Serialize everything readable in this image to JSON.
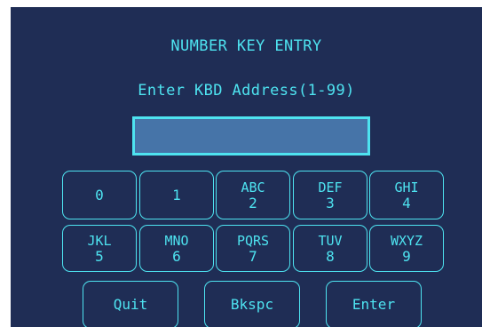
{
  "title": "NUMBER KEY ENTRY",
  "prompt": "Enter KBD Address(1-99)",
  "entry": {
    "value": ""
  },
  "keypad": {
    "row1": [
      {
        "letters": "",
        "digit": "0"
      },
      {
        "letters": "",
        "digit": "1"
      },
      {
        "letters": "ABC",
        "digit": "2"
      },
      {
        "letters": "DEF",
        "digit": "3"
      },
      {
        "letters": "GHI",
        "digit": "4"
      }
    ],
    "row2": [
      {
        "letters": "JKL",
        "digit": "5"
      },
      {
        "letters": "MNO",
        "digit": "6"
      },
      {
        "letters": "PQRS",
        "digit": "7"
      },
      {
        "letters": "TUV",
        "digit": "8"
      },
      {
        "letters": "WXYZ",
        "digit": "9"
      }
    ]
  },
  "actions": {
    "quit": "Quit",
    "backspace": "Bkspc",
    "enter": "Enter"
  },
  "colors": {
    "background": "#1f2d55",
    "accent": "#4ee3f0",
    "field": "#4674a8"
  }
}
